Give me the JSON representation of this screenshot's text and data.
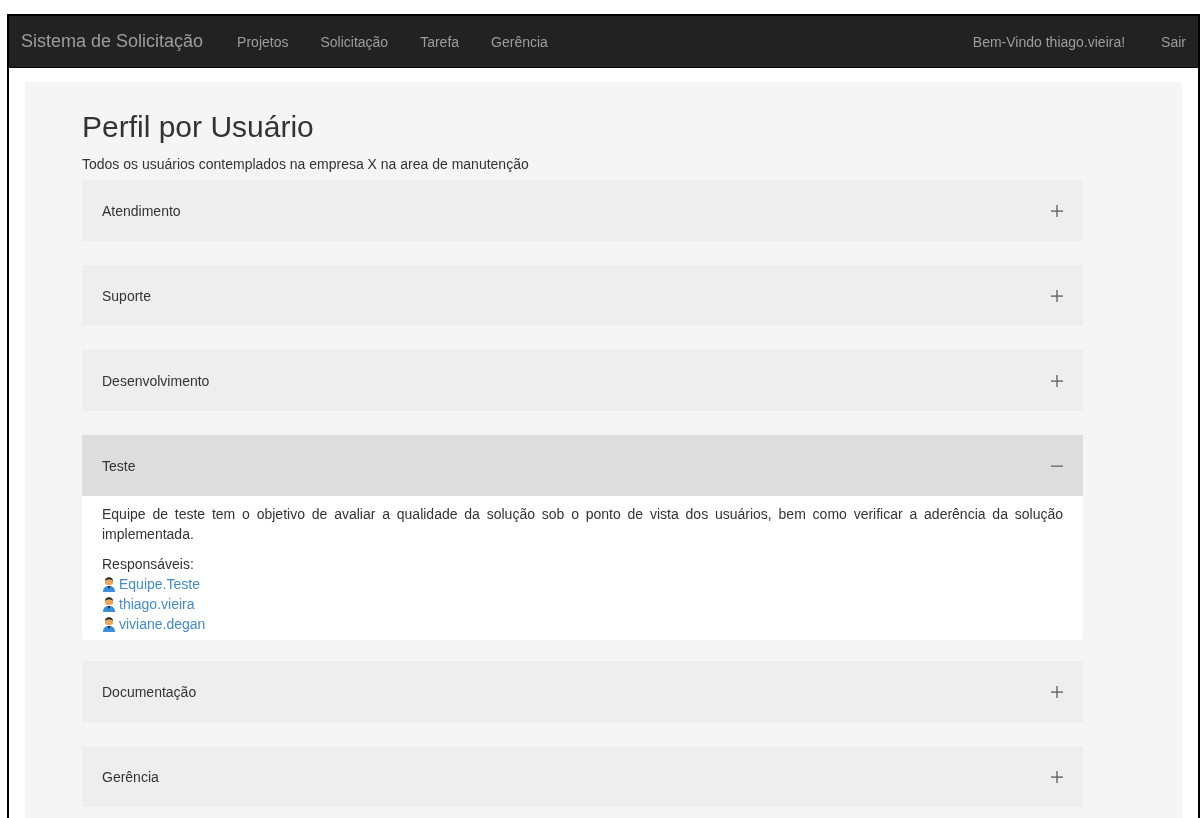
{
  "navbar": {
    "brand": "Sistema de Solicitação",
    "links": [
      "Projetos",
      "Solicitação",
      "Tarefa",
      "Gerência"
    ],
    "welcome": "Bem-Vindo thiago.vieira!",
    "logout": "Sair"
  },
  "page": {
    "title": "Perfil por Usuário",
    "subtitle": "Todos os usuários contemplados na empresa X na area de manutenção"
  },
  "sections": [
    {
      "title": "Atendimento",
      "expanded": false
    },
    {
      "title": "Suporte",
      "expanded": false
    },
    {
      "title": "Desenvolvimento",
      "expanded": false
    },
    {
      "title": "Teste",
      "expanded": true,
      "description": "Equipe de teste tem o objetivo de avaliar a qualidade da solução sob o ponto de vista dos usuários, bem como verificar a aderência da solução implementada.",
      "members_label": "Responsáveis:",
      "members": [
        "Equipe.Teste",
        "thiago.vieira",
        "viviane.degan"
      ]
    },
    {
      "title": "Documentação",
      "expanded": false
    },
    {
      "title": "Gerência",
      "expanded": false
    }
  ]
}
